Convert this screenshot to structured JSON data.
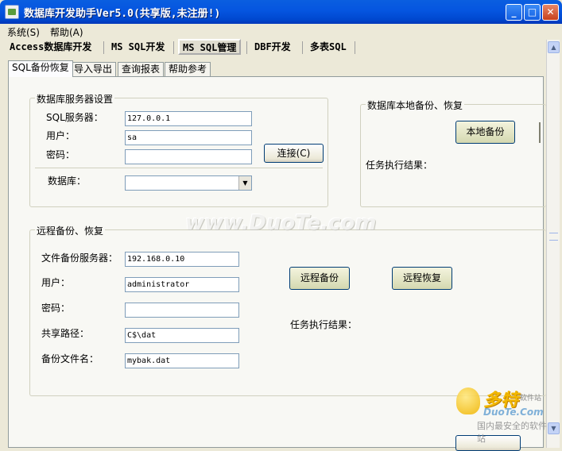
{
  "window": {
    "title": "数据库开发助手Ver5.0(共享版,未注册!)",
    "minimize": "_",
    "maximize": "□",
    "close": "✕"
  },
  "menu": [
    "系统(S)",
    "帮助(A)"
  ],
  "top_tabs": [
    "Access数据库开发",
    "MS SQL开发",
    "MS SQL管理",
    "DBF开发",
    "多表SQL"
  ],
  "sub_tabs": [
    "SQL备份恢复",
    "导入导出",
    "查询报表",
    "帮助参考"
  ],
  "server_group": {
    "legend": "数据库服务器设置",
    "server_label": "SQL服务器：",
    "server_value": "127.0.0.1",
    "user_label": "用户：",
    "user_value": "sa",
    "password_label": "密码：",
    "password_value": "",
    "connect_label": "连接(C)",
    "database_label": "数据库：",
    "database_value": ""
  },
  "local_group": {
    "legend": "数据库本地备份、恢复",
    "backup_label": "本地备份",
    "result_label": "任务执行结果："
  },
  "remote_group": {
    "legend": "远程备份、恢复",
    "server_label": "文件备份服务器：",
    "server_value": "192.168.0.10",
    "user_label": "用户：",
    "user_value": "administrator",
    "password_label": "密码：",
    "password_value": "",
    "share_label": "共享路径：",
    "share_value": "C$\\dat",
    "file_label": "备份文件名：",
    "file_value": "mybak.dat",
    "backup_label": "远程备份",
    "restore_label": "远程恢复",
    "result_label": "任务执行结果："
  },
  "watermark": "www.DuoTe.com",
  "logo": {
    "name": "多特",
    "sub": "软件站",
    "url": "DuoTe.Com",
    "slogan": "国内最安全的软件站"
  },
  "colors": {
    "titlebar": "#0a5ee0",
    "window_bg": "#ece9d8",
    "panel_bg": "#f8f8f4"
  }
}
